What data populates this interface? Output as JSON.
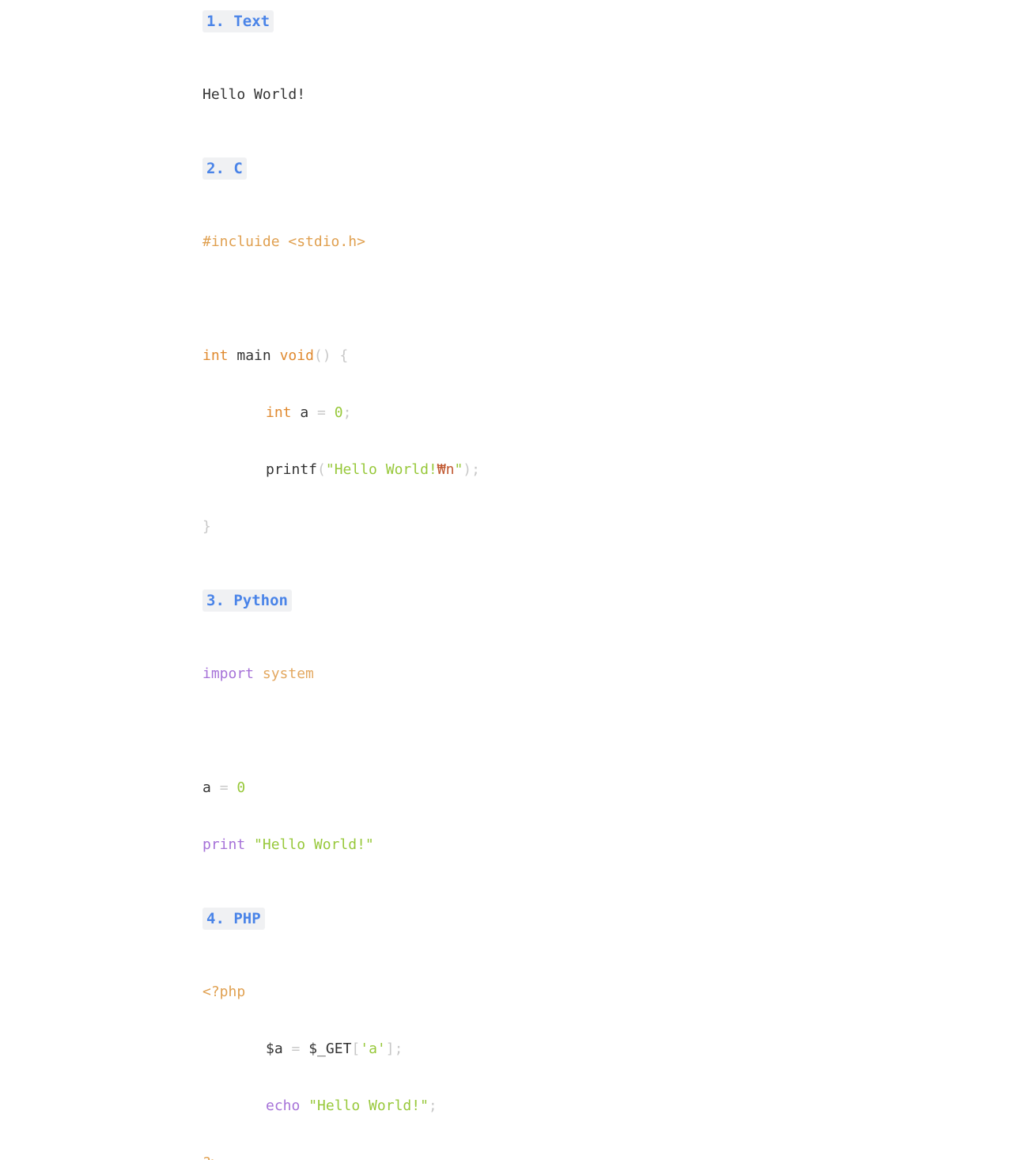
{
  "sections": [
    {
      "heading": "1. Text"
    },
    {
      "heading": "2. C"
    },
    {
      "heading": "3. Python"
    },
    {
      "heading": "4. PHP"
    }
  ],
  "text": {
    "line1": "Hello World!"
  },
  "c": {
    "include": "#incluide <stdio.h>",
    "int_kw": "int",
    "main": "main",
    "void_kw": "void",
    "paren_brace": "() {",
    "int_kw2": "int",
    "var_a": "a",
    "eq": "=",
    "zero": "0",
    "semicolon": ";",
    "printf": "printf",
    "paren_open": "(",
    "str_start": "\"Hello World!",
    "escape": "₩n",
    "str_end": "\"",
    "paren_close": ");",
    "close_brace": "}"
  },
  "python": {
    "import_kw": "import",
    "module": "system",
    "var_a": "a",
    "eq": "=",
    "zero": "0",
    "print_kw": "print",
    "str": "\"Hello World!\""
  },
  "php": {
    "open_tag": "<?php",
    "var_a": "$a",
    "eq": "=",
    "get": "$_GET",
    "bracket_open": "[",
    "key": "'a'",
    "bracket_close": "];",
    "echo_kw": "echo",
    "str": "\"Hello World!\"",
    "semicolon": ";",
    "close_tag": "?>"
  },
  "colors": {
    "heading_text": "#4a84e8",
    "heading_bg": "#f0f1f3",
    "orange": "#e0a050",
    "green": "#97c83a",
    "purple": "#a672d8",
    "escape": "#c0572f"
  }
}
